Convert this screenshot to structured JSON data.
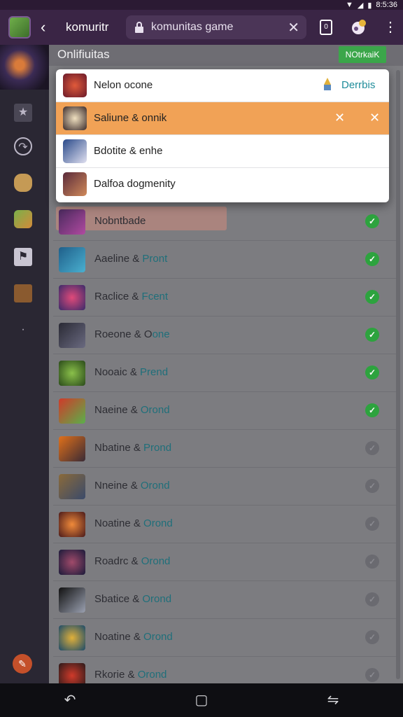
{
  "status_bar": {
    "time": "8:5:36"
  },
  "topbar": {
    "app_title": "komuritr",
    "url_value": "komunitas game",
    "clear_icon": "close-icon",
    "back_icon": "chevron-left-icon",
    "tab_count": "0",
    "menu_icon": "more-vert-icon"
  },
  "main": {
    "header_title": "Onlifiuitas",
    "notify_button": "NOtrkaiK"
  },
  "popup": {
    "rows": [
      {
        "label": "Nelon ocone",
        "link": "Derrbis"
      },
      {
        "label": "Saliune & onnik"
      },
      {
        "label": "Bdotite & enhe"
      },
      {
        "label": "Dalfoa dogmenity"
      }
    ]
  },
  "list": {
    "rows": [
      {
        "name": "Nobntbade",
        "accent": "",
        "status": "done"
      },
      {
        "name": "Aaeline & ",
        "accent": "Pront",
        "status": "done"
      },
      {
        "name": "Raclice & ",
        "accent": "Fcent",
        "status": "done"
      },
      {
        "name": "Roeone & O",
        "accent": "one",
        "status": "done"
      },
      {
        "name": "Nooaic & ",
        "accent": "Prend",
        "status": "done"
      },
      {
        "name": "Naeine & ",
        "accent": "Orond",
        "status": "done"
      },
      {
        "name": "Nbatine & ",
        "accent": "Prond",
        "status": "todo"
      },
      {
        "name": "Nneine & ",
        "accent": "Orond",
        "status": "todo"
      },
      {
        "name": "Noatine & ",
        "accent": "Orond",
        "status": "todo"
      },
      {
        "name": "Roadrc & ",
        "accent": "Orond",
        "status": "todo"
      },
      {
        "name": "Sbatice & ",
        "accent": "Orond",
        "status": "todo"
      },
      {
        "name": "Noatine & ",
        "accent": "Orond",
        "status": "todo"
      },
      {
        "name": "Rkorie & ",
        "accent": "Orond",
        "status": "todo"
      }
    ]
  },
  "colors": {
    "accent_green": "#2da33e",
    "active_orange": "#f1a256",
    "link_teal": "#1e8c9a",
    "topbar_purple": "#3a2545"
  }
}
